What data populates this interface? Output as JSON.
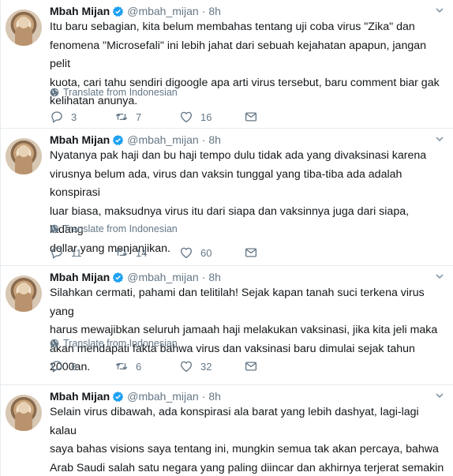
{
  "tweets": [
    {
      "name": "Mbah Mijan",
      "handle": "@mbah_mijan",
      "separator": "·",
      "time": "8h",
      "text": "Itu baru sebagian, kita belum membahas tentang uji coba virus \"Zika\" dan\nfenomena \"Microsefali\" ini lebih jahat dari sebuah kejahatan apapun, jangan pelit\nkuota, cari tahu sendiri digoogle apa arti virus tersebut, baru comment biar gak\nkelihatan anunya.",
      "translate": "Translate from Indonesian",
      "replies": "3",
      "retweets": "7",
      "likes": "16"
    },
    {
      "name": "Mbah Mijan",
      "handle": "@mbah_mijan",
      "separator": "·",
      "time": "8h",
      "text": "Nyatanya pak haji dan bu haji tempo dulu tidak ada yang divaksinasi karena\nvirusnya belum ada, virus dan vaksin tunggal yang tiba-tiba ada adalah konspirasi\nluar biasa, maksudnya virus itu dari siapa dan vaksinnya juga dari siapa, ladang\ndollar yang menjanjikan.",
      "translate": "Translate from Indonesian",
      "replies": "11",
      "retweets": "14",
      "likes": "60"
    },
    {
      "name": "Mbah Mijan",
      "handle": "@mbah_mijan",
      "separator": "·",
      "time": "8h",
      "text": "Silahkan cermati, pahami dan telitilah! Sejak kapan tanah suci terkena virus yang\nharus mewajibkan seluruh jamaah haji melakukan vaksinasi, jika kita jeli maka\nakan mendapati fakta bahwa virus dan vaksinasi baru dimulai sejak tahun 2000an.",
      "translate": "Translate from Indonesian",
      "replies": "6",
      "retweets": "6",
      "likes": "32"
    },
    {
      "name": "Mbah Mijan",
      "handle": "@mbah_mijan",
      "separator": "·",
      "time": "8h",
      "text": "Selain virus dibawah, ada konspirasi ala barat yang lebih dashyat, lagi-lagi kalau\nsaya bahas visions saya tentang ini, mungkin semua tak akan percaya, bahwa\nArab Saudi salah satu negara yang paling diincar dan akhirnya terjerat semakin\ndalam, entah sadar entah tidak."
    }
  ],
  "colors": {
    "verified": "#1da1f2",
    "icon": "#657786",
    "text": "#14171a",
    "divider": "#e6ecf0"
  },
  "icons": [
    "verified-badge-icon",
    "caret-down-icon",
    "globe-icon",
    "reply-icon",
    "retweet-icon",
    "like-icon",
    "message-icon"
  ]
}
